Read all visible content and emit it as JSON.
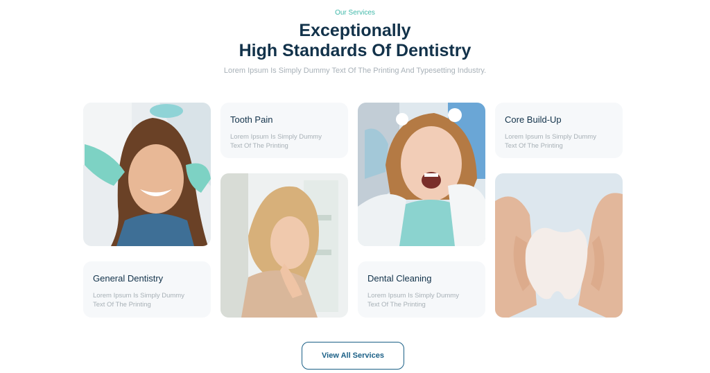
{
  "header": {
    "eyebrow": "Our Services",
    "title_line1": "Exceptionally",
    "title_line2": "High Standards Of Dentistry",
    "subtitle": "Lorem Ipsum Is Simply Dummy Text Of The Printing And Typesetting Industry."
  },
  "services": [
    {
      "title": "Tooth Pain",
      "desc": "Lorem Ipsum Is Simply Dummy Text Of The Printing"
    },
    {
      "title": "Core Build-Up",
      "desc": "Lorem Ipsum Is Simply Dummy Text Of The Printing"
    },
    {
      "title": "General Dentistry",
      "desc": "Lorem Ipsum Is Simply Dummy Text Of The Printing"
    },
    {
      "title": "Dental Cleaning",
      "desc": "Lorem Ipsum Is Simply Dummy Text Of The Printing"
    }
  ],
  "cta": {
    "label": "View All Services"
  },
  "colors": {
    "accent": "#3fb8a9",
    "heading": "#12324a",
    "button": "#1a5f86",
    "card_bg": "#f6f8fa"
  }
}
